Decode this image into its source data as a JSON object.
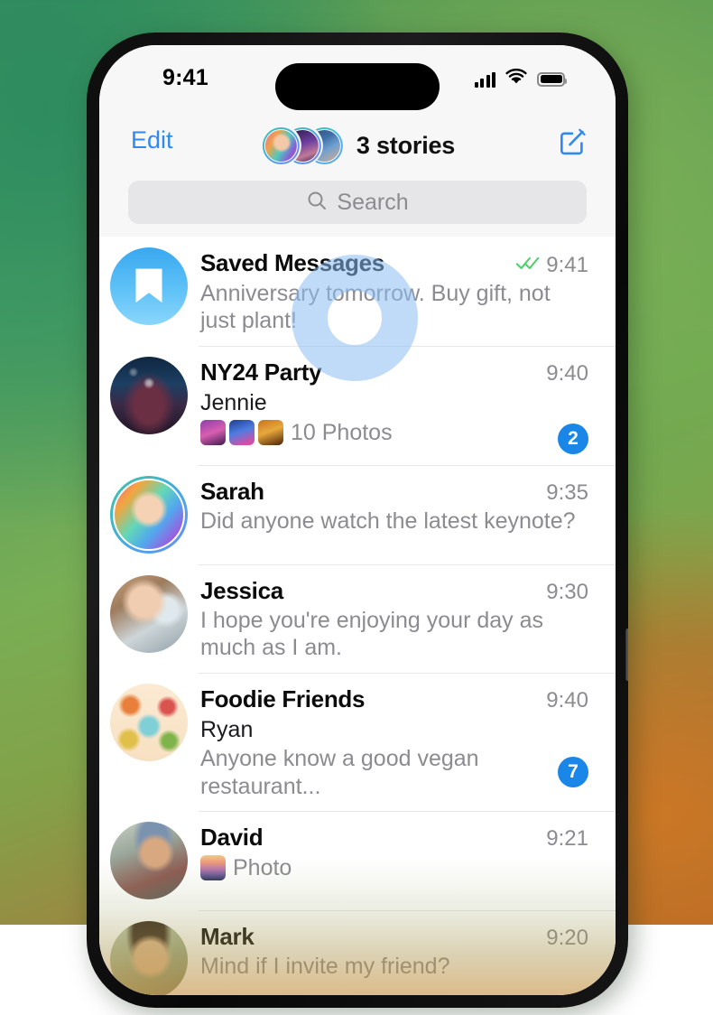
{
  "status_bar": {
    "time": "9:41",
    "signal_icon": "cellular-bars-icon",
    "wifi_icon": "wifi-icon",
    "battery_icon": "battery-full-icon"
  },
  "nav_bar": {
    "edit_label": "Edit",
    "stories_label": "3 stories",
    "compose_icon": "compose-icon",
    "story_avatars": [
      "story-avatar-1",
      "story-avatar-2",
      "story-avatar-3"
    ]
  },
  "search": {
    "placeholder": "Search",
    "icon": "search-icon"
  },
  "chats": [
    {
      "title": "Saved Messages",
      "sender": "",
      "preview": "Anniversary tomorrow. Buy gift, not just plant!",
      "time": "9:41",
      "read_status": "read-double-check",
      "badge": "",
      "avatar_kind": "saved-messages-bookmark",
      "has_story_ring": false,
      "thumbs": 0,
      "thumb_label": ""
    },
    {
      "title": "NY24 Party",
      "sender": "Jennie",
      "preview": "",
      "time": "9:40",
      "read_status": "",
      "badge": "2",
      "avatar_kind": "photo-deer-party",
      "has_story_ring": false,
      "thumbs": 3,
      "thumb_label": "10 Photos"
    },
    {
      "title": "Sarah",
      "sender": "",
      "preview": "Did anyone watch the latest keynote?",
      "time": "9:35",
      "read_status": "",
      "badge": "",
      "avatar_kind": "photo-sarah",
      "has_story_ring": true,
      "thumbs": 0,
      "thumb_label": ""
    },
    {
      "title": "Jessica",
      "sender": "",
      "preview": "I hope you're enjoying your day as much as I am.",
      "time": "9:30",
      "read_status": "",
      "badge": "",
      "avatar_kind": "photo-jessica",
      "has_story_ring": false,
      "thumbs": 0,
      "thumb_label": ""
    },
    {
      "title": "Foodie Friends",
      "sender": "Ryan",
      "preview": "Anyone know a good vegan restaurant...",
      "time": "9:40",
      "read_status": "",
      "badge": "7",
      "avatar_kind": "photo-foodie",
      "has_story_ring": false,
      "thumbs": 0,
      "thumb_label": ""
    },
    {
      "title": "David",
      "sender": "",
      "preview": "Photo",
      "time": "9:21",
      "read_status": "",
      "badge": "",
      "avatar_kind": "photo-david",
      "has_story_ring": false,
      "thumbs": 1,
      "thumb_label": "Photo"
    },
    {
      "title": "Mark",
      "sender": "",
      "preview": "Mind if I invite my friend?",
      "time": "9:20",
      "read_status": "",
      "badge": "",
      "avatar_kind": "photo-mark",
      "has_story_ring": false,
      "thumbs": 0,
      "thumb_label": ""
    }
  ],
  "colors": {
    "accent_blue": "#2f89ef",
    "badge_blue": "#1a86e8",
    "tick_green": "#4cd06a",
    "secondary_text": "#8b8b90",
    "search_bg": "#e6e6e8",
    "chrome_bg": "#f7f7f8"
  },
  "overlay": {
    "tap_indicator": "tap-ring-cursor"
  }
}
